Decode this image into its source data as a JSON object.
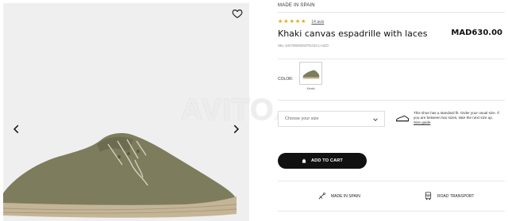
{
  "watermark": {
    "main": "AVITO",
    "suffix": ".MA"
  },
  "gallery": {
    "wishlist_icon": "heart-icon",
    "prev_icon": "chevron-left-icon",
    "next_icon": "chevron-right-icon"
  },
  "product": {
    "origin_top": "MADE IN SPAIN",
    "rating": {
      "stars": 5,
      "value": 5,
      "reviews_label": "14 avis"
    },
    "title": "Khaki canvas espadrille with laces",
    "price": "MAD630.00",
    "sku": "Sku 10278500003TE210 LAIZO"
  },
  "color": {
    "label": "COLOR:",
    "selected": "Khaki"
  },
  "size": {
    "placeholder": "Choose your size",
    "fit_note": "This shoe has a standard fit. Order your usual size. If you are between two sizes, take the next size up.",
    "size_guide_label": "Size guide"
  },
  "cart": {
    "label": "ADD TO CART",
    "icon": "bag-icon"
  },
  "features": [
    {
      "icon": "needle-icon",
      "label": "MADE IN SPAIN"
    },
    {
      "icon": "truck-icon",
      "label": "ROAD TRANSPORT"
    }
  ],
  "colors": {
    "star": "#e0a81a",
    "button": "#111111",
    "khaki": "#7d7d5e",
    "jute": "#c4b596"
  }
}
